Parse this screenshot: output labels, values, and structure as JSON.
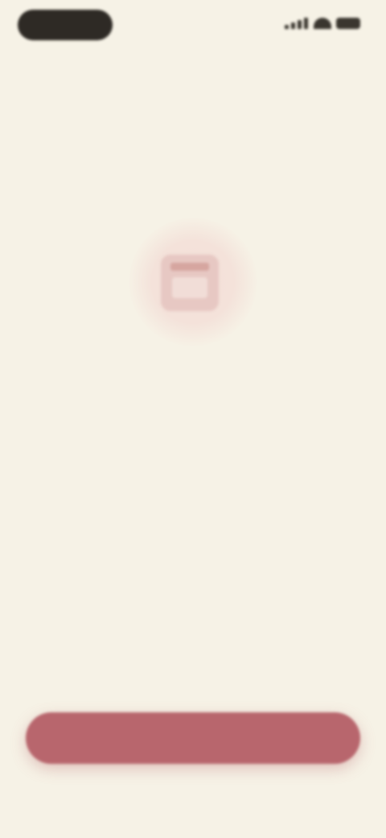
{
  "status_bar": {
    "time": ""
  },
  "colors": {
    "background": "#f6f2e6",
    "accent": "#b8666d",
    "icon_tint": "#e7c8c3"
  },
  "hero": {
    "icon": "calendar-icon"
  },
  "title": "",
  "subtitle": "",
  "footer": {
    "secondary_link": "",
    "primary_button": ""
  }
}
